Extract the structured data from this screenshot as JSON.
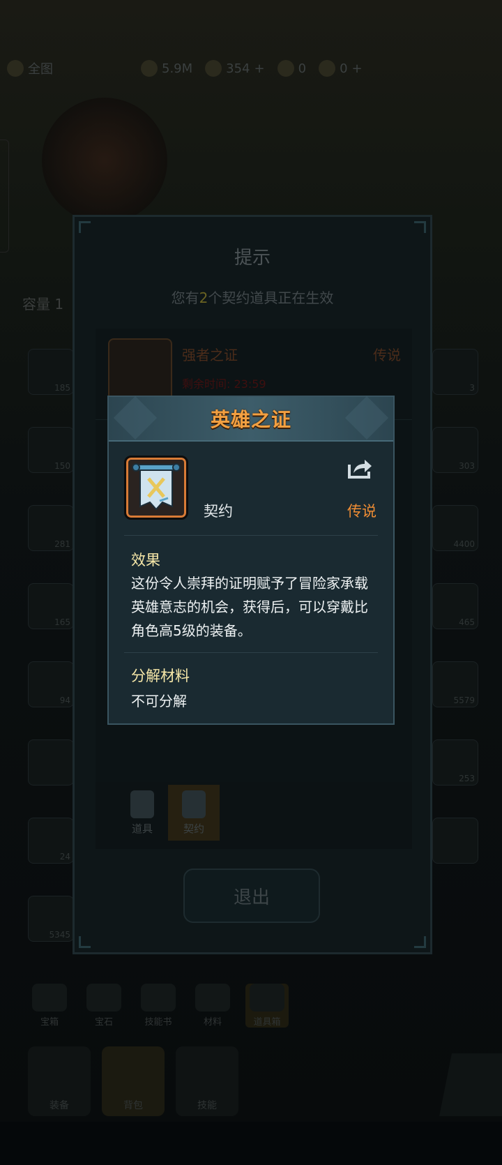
{
  "background": {
    "topbar": {
      "title": "全图",
      "resources": [
        "5.9M",
        "354",
        "0",
        "0"
      ]
    },
    "bag_label": "容量 1",
    "slot_counts": [
      "185",
      "150",
      "281",
      "165",
      "94",
      "5345",
      "24",
      "3",
      "303",
      "4400",
      "465",
      "5579",
      "253"
    ],
    "nav_items": [
      "宝箱",
      "宝石",
      "技能书",
      "材料",
      "道具箱"
    ],
    "bottom_items": [
      "装备",
      "背包",
      "技能"
    ]
  },
  "tip_dialog": {
    "title": "提示",
    "subtitle_pre": "您有",
    "subtitle_count": "2",
    "subtitle_post": "个契约道具正在生效",
    "items": [
      {
        "name": "强者之证",
        "rarity": "传说",
        "time": "剩余时间: 23:59"
      }
    ],
    "tabs": [
      {
        "label": "道具"
      },
      {
        "label": "契约"
      }
    ],
    "exit_label": "退出"
  },
  "detail": {
    "title": "英雄之证",
    "item_type": "契约",
    "rarity": "传说",
    "effect_title": "效果",
    "effect_text": "这份令人崇拜的证明赋予了冒险家承载英雄意志的机会，获得后，可以穿戴比角色高5级的装备。",
    "material_title": "分解材料",
    "material_text": "不可分解"
  },
  "colors": {
    "title_orange": "#f3a041",
    "rarity_orange": "#f08d34",
    "section_title": "#f6e7a8",
    "panel_bg": "#1a2a31"
  }
}
